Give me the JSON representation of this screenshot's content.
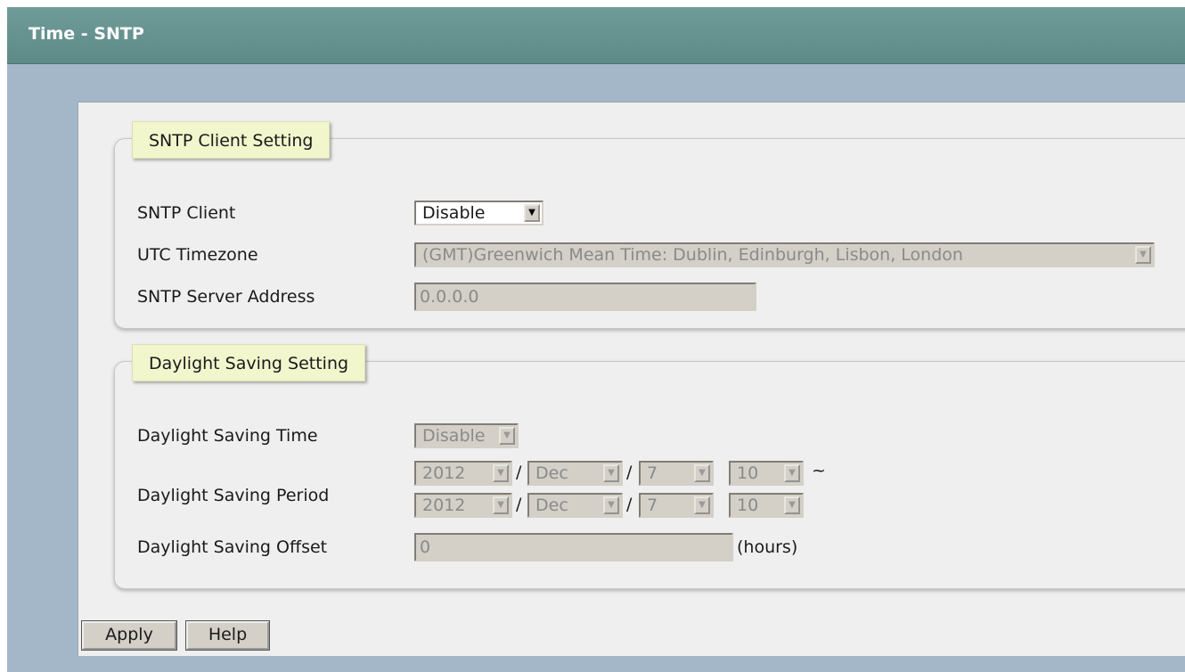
{
  "header": {
    "title": "Time - SNTP"
  },
  "sntp_client_setting": {
    "legend": "SNTP Client Setting",
    "sntp_client": {
      "label": "SNTP Client",
      "value": "Disable"
    },
    "utc_timezone": {
      "label": "UTC Timezone",
      "value": "(GMT)Greenwich Mean Time: Dublin, Edinburgh, Lisbon, London"
    },
    "server_address": {
      "label": "SNTP Server Address",
      "value": "0.0.0.0"
    }
  },
  "daylight_saving_setting": {
    "legend": "Daylight Saving Setting",
    "dst_time": {
      "label": "Daylight Saving Time",
      "value": "Disable"
    },
    "period": {
      "label": "Daylight Saving Period",
      "start": {
        "year": "2012",
        "month": "Dec",
        "day": "7",
        "hour": "10"
      },
      "end": {
        "year": "2012",
        "month": "Dec",
        "day": "7",
        "hour": "10"
      },
      "date_separator": "/",
      "range_separator": "~"
    },
    "offset": {
      "label": "Daylight Saving Offset",
      "value": "0",
      "unit": "(hours)"
    }
  },
  "actions": {
    "apply": "Apply",
    "help": "Help"
  }
}
